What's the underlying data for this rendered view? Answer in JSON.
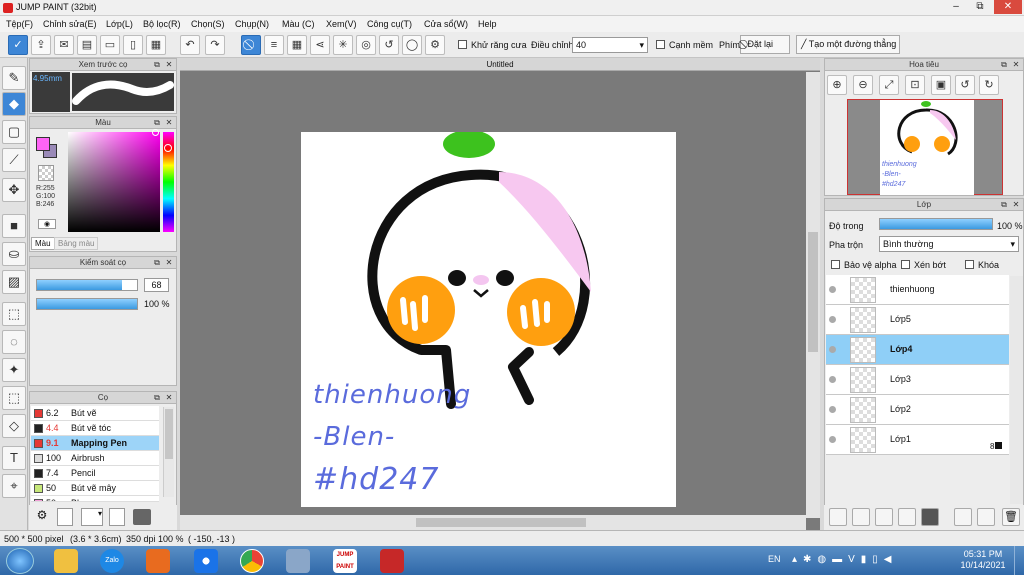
{
  "window": {
    "title": "JUMP PAINT (32bit)",
    "min": "–",
    "max": "⧉",
    "close": "✕"
  },
  "menu": [
    "Tệp(F)",
    "Chỉnh sửa(E)",
    "Lớp(L)",
    "Bộ lọc(R)",
    "Chọn(S)",
    "Chụp(N)",
    "Màu (C)",
    "Xem(V)",
    "Công cụ(T)",
    "Cửa sổ(W)",
    "Help"
  ],
  "toolbar": {
    "antialias": "Khử răng cưa",
    "adjust": "Điều chỉnh",
    "adjust_value": "40",
    "edge": "Cạnh mềm",
    "key": "Phím",
    "reset": "Đặt lại",
    "straight": "Tạo một đường thẳng"
  },
  "preview": {
    "title": "Xem trước cọ",
    "size": "4.95mm"
  },
  "color": {
    "title": "Màu",
    "r": "R:255",
    "g": "G:100",
    "b": "B:246",
    "tab1": "Màu",
    "tab2": "Bảng màu",
    "primary": "#ff64f6"
  },
  "brush_control": {
    "title": "Kiểm soát cọ",
    "size": "68",
    "opacity": "100 %",
    "size_fraction": 0.85,
    "opacity_fraction": 1.0
  },
  "brushes": {
    "title": "Cọ",
    "items": [
      {
        "size": "6.2",
        "name": "Bút vẽ",
        "color": "#e53935"
      },
      {
        "size": "4.4",
        "name": "Bút vẽ tóc",
        "color": "#222222"
      },
      {
        "size": "9.1",
        "name": "Mapping Pen",
        "color": "#e53935"
      },
      {
        "size": "100",
        "name": "Airbrush",
        "color": "#dddddd"
      },
      {
        "size": "7.4",
        "name": "Pencil",
        "color": "#222222"
      },
      {
        "size": "50",
        "name": "Bút vẽ mây",
        "color": "#c7e87a"
      },
      {
        "size": "50",
        "name": "Blur",
        "color": "#f2a0d8"
      }
    ],
    "selected": 2
  },
  "canvas": {
    "tab": "Untitled",
    "sign1": "thienhuong",
    "sign2": "-Blen-",
    "sign3": "#hd247"
  },
  "navigator": {
    "title": "Hoa tiêu",
    "sign1": "thienhuong",
    "sign2": "-Blen-",
    "sign3": "#hd247"
  },
  "layers": {
    "title": "Lớp",
    "opacity_label": "Độ trong",
    "opacity": "100 %",
    "blend_label": "Pha trộn",
    "blend": "Bình thường",
    "alpha": "Bảo vệ alpha",
    "clip": "Xén bớt",
    "lock": "Khóa",
    "badge": "8",
    "items": [
      "thienhuong",
      "Lớp5",
      "Lớp4",
      "Lớp3",
      "Lớp2",
      "Lớp1"
    ],
    "selected": 2
  },
  "status": {
    "pixel": "500 * 500 pixel",
    "size": "(3.6 * 3.6cm)",
    "dpi": "350 dpi",
    "zoom": "100 %",
    "coords": "( -150, -13 )"
  },
  "taskbar": {
    "lang": "EN",
    "time": "05:31 PM",
    "date": "10/14/2021",
    "zalo": "Zalo",
    "jump": "JUMP PAINT"
  }
}
